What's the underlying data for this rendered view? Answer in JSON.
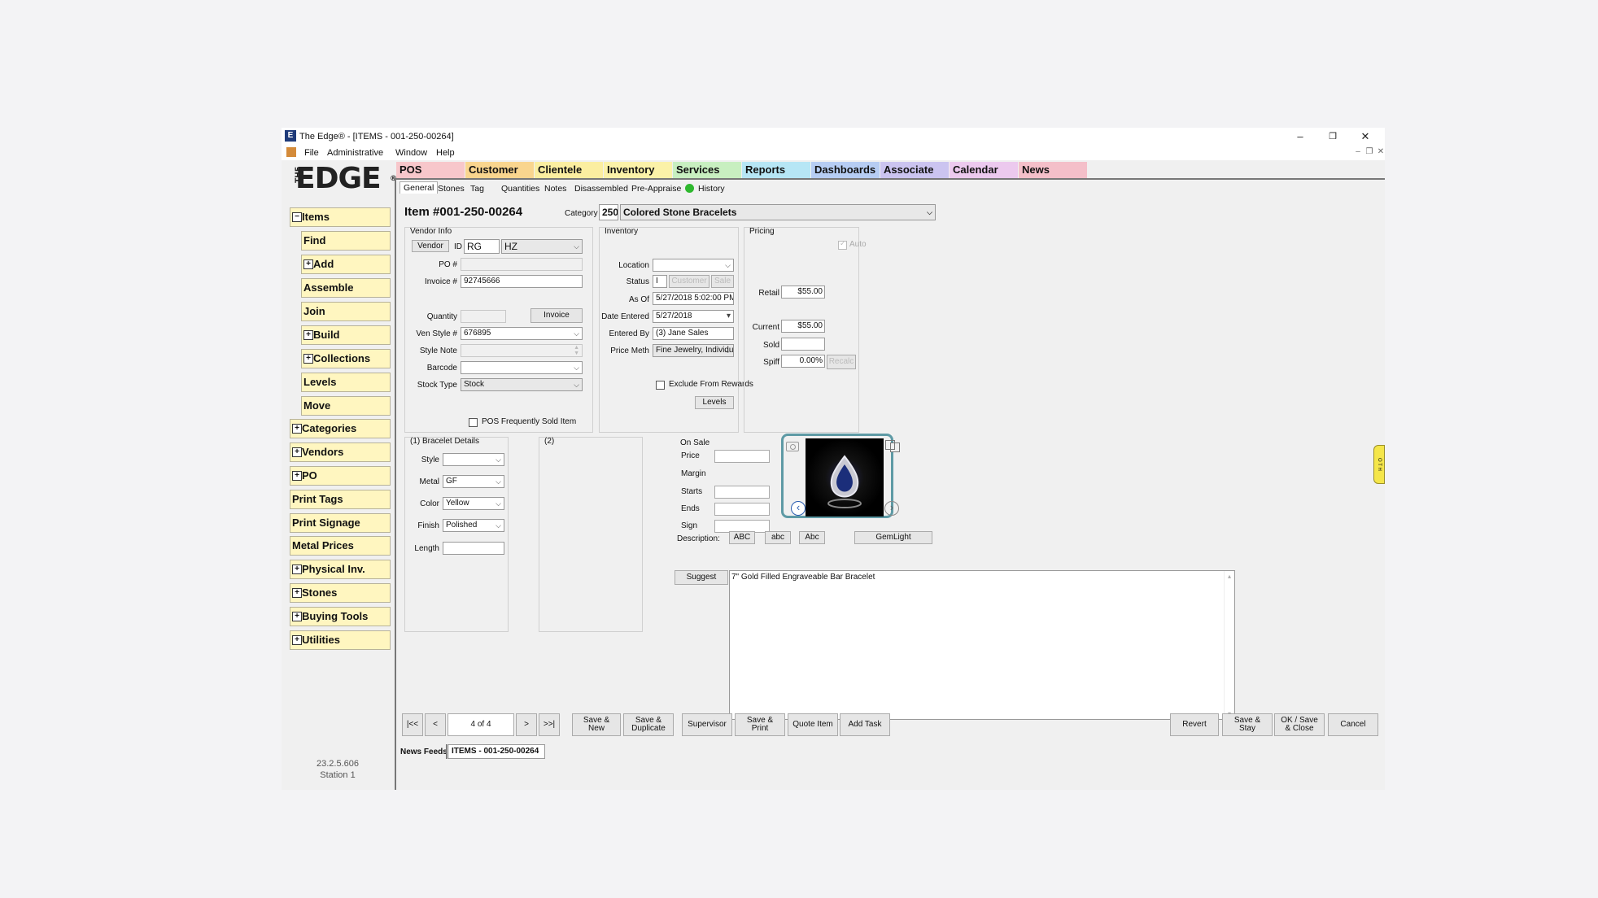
{
  "window": {
    "title": "The Edge® - [ITEMS - 001-250-00264]",
    "min": "–",
    "max": "❐",
    "close": "✕"
  },
  "menu": [
    "File",
    "Administrative",
    "Window",
    "Help"
  ],
  "logo": {
    "the": "THE",
    "edge": "EDGE",
    "reg": "®"
  },
  "top_tabs": [
    {
      "label": "POS",
      "color": "#f7c7cb"
    },
    {
      "label": "Customer",
      "color": "#f9d58e"
    },
    {
      "label": "Clientele",
      "color": "#fbeea0"
    },
    {
      "label": "Inventory",
      "color": "#fbf2a8"
    },
    {
      "label": "Services",
      "color": "#c8efc0"
    },
    {
      "label": "Reports",
      "color": "#b6e6f5"
    },
    {
      "label": "Dashboards",
      "color": "#b6cdf3"
    },
    {
      "label": "Associate",
      "color": "#cbc4f0"
    },
    {
      "label": "Calendar",
      "color": "#ecc9ee"
    },
    {
      "label": "News",
      "color": "#f4bfc9"
    }
  ],
  "sub_tabs": [
    "General",
    "Stones",
    "Tag",
    "Quantities",
    "Notes",
    "Disassembled",
    "Pre-Appraise",
    "History"
  ],
  "sidebar": [
    {
      "label": "Items",
      "pm": "−"
    },
    {
      "label": "Find"
    },
    {
      "label": "Add",
      "pm": "+"
    },
    {
      "label": "Assemble"
    },
    {
      "label": "Join"
    },
    {
      "label": "Build",
      "pm": "+"
    },
    {
      "label": "Collections",
      "pm": "+"
    },
    {
      "label": "Levels"
    },
    {
      "label": "Move"
    },
    {
      "label": "Categories",
      "pm": "+"
    },
    {
      "label": "Vendors",
      "pm": "+"
    },
    {
      "label": "PO",
      "pm": "+"
    },
    {
      "label": "Print Tags"
    },
    {
      "label": "Print Signage"
    },
    {
      "label": "Metal Prices"
    },
    {
      "label": "Physical Inv.",
      "pm": "+"
    },
    {
      "label": "Stones",
      "pm": "+"
    },
    {
      "label": "Buying Tools",
      "pm": "+"
    },
    {
      "label": "Utilities",
      "pm": "+"
    }
  ],
  "version": {
    "number": "23.2.5.606",
    "station": "Station 1"
  },
  "item": {
    "title": "Item #001-250-00264",
    "category_label": "Category",
    "category_code": "250",
    "category_name": "Colored Stone Bracelets"
  },
  "vendor": {
    "title": "Vendor Info",
    "vendor_btn": "Vendor",
    "id_label": "ID",
    "id": "RG",
    "id2": "HZ",
    "po_label": "PO #",
    "po": "",
    "invoice_label": "Invoice #",
    "invoice": "92745666",
    "qty_label": "Quantity",
    "qty": "",
    "invoice_btn": "Invoice",
    "venstyle_label": "Ven Style #",
    "venstyle": "676895",
    "stylenote_label": "Style Note",
    "barcode_label": "Barcode",
    "stocktype_label": "Stock Type",
    "stocktype": "Stock",
    "pos_freq": "POS Frequently Sold Item"
  },
  "inventory": {
    "title": "Inventory",
    "location_label": "Location",
    "location": "",
    "status_label": "Status",
    "status": "I",
    "customer_btn": "Customer",
    "sale_btn": "Sale",
    "asof_label": "As Of",
    "asof": "5/27/2018 5:02:00 PM",
    "dateentered_label": "Date Entered",
    "dateentered": "5/27/2018",
    "enteredby_label": "Entered By",
    "enteredby": "(3) Jane Sales",
    "pricemeth_label": "Price Meth",
    "pricemeth": "Fine Jewelry, Individual Iter",
    "exclude": "Exclude From Rewards",
    "levels_btn": "Levels"
  },
  "pricing": {
    "title": "Pricing",
    "auto": "Auto",
    "retail_label": "Retail",
    "retail": "$55.00",
    "current_label": "Current",
    "current": "$55.00",
    "sold_label": "Sold",
    "sold": "",
    "spiff_label": "Spiff",
    "spiff": "0.00%",
    "recalc_btn": "Recalc"
  },
  "bracelet": {
    "title": "(1) Bracelet Details",
    "style_label": "Style",
    "style": "",
    "metal_label": "Metal",
    "metal": "GF",
    "color_label": "Color",
    "color": "Yellow",
    "finish_label": "Finish",
    "finish": "Polished",
    "length_label": "Length",
    "length": ""
  },
  "details2": {
    "title": "(2)"
  },
  "onsale": {
    "title": "On Sale",
    "price": "Price",
    "margin": "Margin",
    "starts": "Starts",
    "ends": "Ends",
    "sign": "Sign"
  },
  "description": {
    "label": "Description:",
    "abc_upper": "ABC",
    "abc_lower": "abc",
    "abc_title": "Abc",
    "gemlight": "GemLight",
    "suggest": "Suggest",
    "text": "7\" Gold Filled Engraveable Bar Bracelet"
  },
  "bottom": {
    "first": "|<<",
    "prev": "<",
    "record": "4 of 4",
    "next": ">",
    "last": ">>|",
    "save_new": "Save &\nNew",
    "save_dup": "Save &\nDuplicate",
    "supervisor": "Supervisor",
    "save_print": "Save &\nPrint",
    "quote": "Quote Item",
    "add_task": "Add Task",
    "revert": "Revert",
    "save_stay": "Save &\nStay",
    "ok_save_close": "OK / Save\n& Close",
    "cancel": "Cancel"
  },
  "statusbar": {
    "news": "News Feeds",
    "items_tab": "ITEMS - 001-250-00264"
  },
  "side_tab": "O T H"
}
